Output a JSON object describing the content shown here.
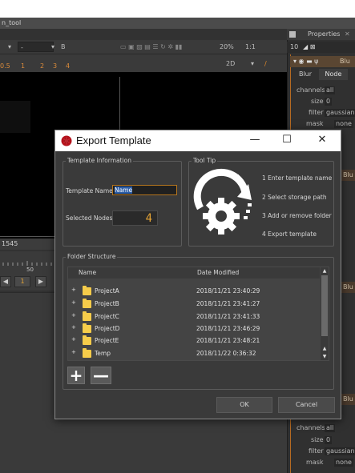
{
  "app": {
    "title": "n_tool",
    "frame_value": "1545",
    "timeline_marker": "50",
    "playback_frame": "1",
    "zoom": "20%",
    "ratio": "1:1",
    "view_mode": "2D",
    "channel_b": "B",
    "ruler_labels": [
      "0.5",
      "1",
      "2",
      "3",
      "4"
    ],
    "viewer_bg": "#000000"
  },
  "properties": {
    "header": "Properties",
    "count": "10",
    "tabs": [
      "Blur",
      "Node"
    ],
    "node_title": "Blu",
    "params": [
      {
        "label": "channels",
        "value": "all"
      },
      {
        "label": "size",
        "value": "0"
      },
      {
        "label": "filter",
        "value": "gaussian"
      },
      {
        "label": "mask",
        "value": "none"
      }
    ],
    "side_items": [
      "Blu",
      "Blu",
      "Blu"
    ],
    "params_bottom": [
      {
        "label": "channels",
        "value": "all"
      },
      {
        "label": "size",
        "value": "0"
      },
      {
        "label": "filter",
        "value": "gaussian"
      },
      {
        "label": "mask",
        "value": "none"
      }
    ],
    "accent": "#b56a22"
  },
  "dialog": {
    "title": "Export Template",
    "minimize": "—",
    "maximize": "☐",
    "close": "✕",
    "template_info": {
      "group_label": "Template Information",
      "name_label": "Template Name",
      "name_value": "Name",
      "nodes_label": "Selected Nodes",
      "nodes_value": "4"
    },
    "tooltip": {
      "group_label": "Tool Tip",
      "steps": [
        "1 Enter template name",
        "2 Select storage path",
        "3 Add or remove folder",
        "4 Export template"
      ]
    },
    "folders": {
      "group_label": "Folder Structure",
      "col_name": "Name",
      "col_date": "Date Modified",
      "rows": [
        {
          "name": "ProjectA",
          "date": "2018/11/21 23:40:29"
        },
        {
          "name": "ProjectB",
          "date": "2018/11/21 23:41:27"
        },
        {
          "name": "ProjectC",
          "date": "2018/11/21 23:41:33"
        },
        {
          "name": "ProjectD",
          "date": "2018/11/21 23:46:29"
        },
        {
          "name": "ProjectE",
          "date": "2018/11/21 23:48:21"
        },
        {
          "name": "Temp",
          "date": "2018/11/22 0:36:32"
        }
      ],
      "add_label": "+",
      "remove_label": "—"
    },
    "ok_label": "OK",
    "cancel_label": "Cancel",
    "accent_orange": "#e5a435",
    "folder_color": "#f6cc4a"
  }
}
